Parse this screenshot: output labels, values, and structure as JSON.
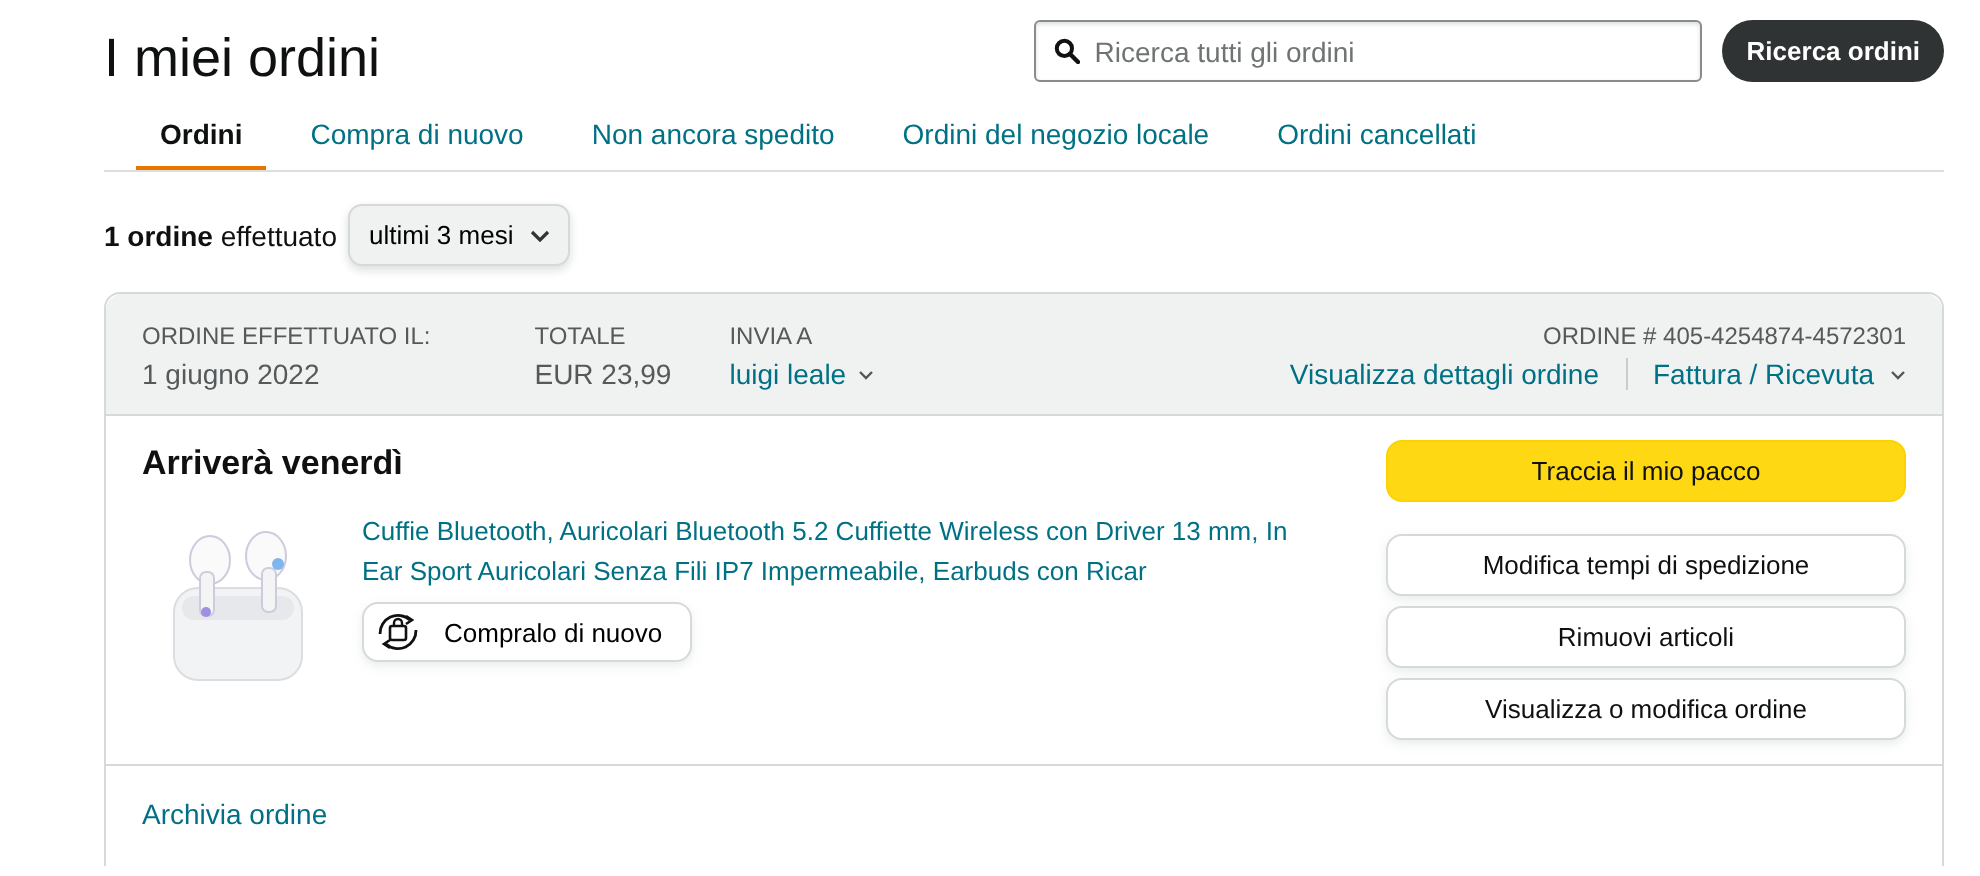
{
  "page_title": "I miei ordini",
  "search": {
    "placeholder": "Ricerca tutti gli ordini",
    "button": "Ricerca ordini"
  },
  "tabs": [
    {
      "label": "Ordini",
      "selected": true
    },
    {
      "label": "Compra di nuovo",
      "selected": false
    },
    {
      "label": "Non ancora spedito",
      "selected": false
    },
    {
      "label": "Ordini del negozio locale",
      "selected": false
    },
    {
      "label": "Ordini cancellati",
      "selected": false
    }
  ],
  "summary": {
    "count": "1 ordine",
    "text": "effettuato",
    "period": "ultimi 3 mesi"
  },
  "order": {
    "header": [
      {
        "label": "ORDINE EFFETTUATO IL:",
        "value": "1 giugno 2022",
        "kind": "text"
      },
      {
        "label": "TOTALE",
        "value": "EUR 23,99",
        "kind": "text"
      },
      {
        "label": "INVIA A",
        "value": "luigi leale",
        "kind": "dropdown"
      }
    ],
    "number": "ORDINE # 405-4254874-4572301",
    "details_link": "Visualizza dettagli ordine",
    "invoice_link": "Fattura / Ricevuta",
    "status": "Arriverà venerdì",
    "item": {
      "title": "Cuffie Bluetooth, Auricolari Bluetooth 5.2 Cuffiette Wireless con Driver 13 mm, In Ear Sport Auricolari Senza Fili IP7 Impermeabile, Earbuds con Ricar",
      "buy_again": "Compralo di nuovo"
    },
    "actions": [
      {
        "label": "Traccia il mio pacco",
        "kind": "primary"
      },
      {
        "label": "Modifica tempi di spedizione",
        "kind": "secondary"
      },
      {
        "label": "Rimuovi articoli",
        "kind": "secondary"
      },
      {
        "label": "Visualizza o modifica ordine",
        "kind": "secondary"
      }
    ],
    "archive_link": "Archivia ordine"
  }
}
